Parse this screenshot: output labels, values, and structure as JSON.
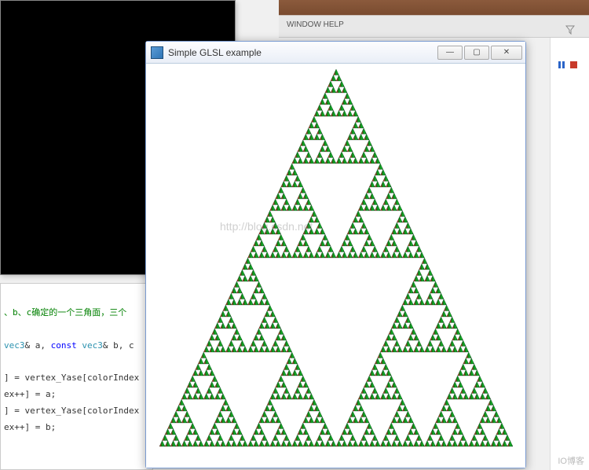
{
  "glsl_window": {
    "title": "Simple GLSL example",
    "minimize": "—",
    "maximize": "▢",
    "close": "✕"
  },
  "code": {
    "comment": "、b、c确定的一个三角面，三个",
    "func_sig_part": " vec3& a, const vec3& b, c",
    "l1_a": "] = vertex_Yase[colorIndex",
    "l1_b": "ex++] = a;",
    "l2_a": "] = vertex_Yase[colorIndex",
    "l2_b": "ex++] = b;",
    "type_kw": "vec3",
    "const_kw": "const"
  },
  "toolbar": {
    "menu_hint": "WINDOW    HELP"
  },
  "watermark": "http://blog.csdn.net",
  "blog_watermark": "IO博客"
}
